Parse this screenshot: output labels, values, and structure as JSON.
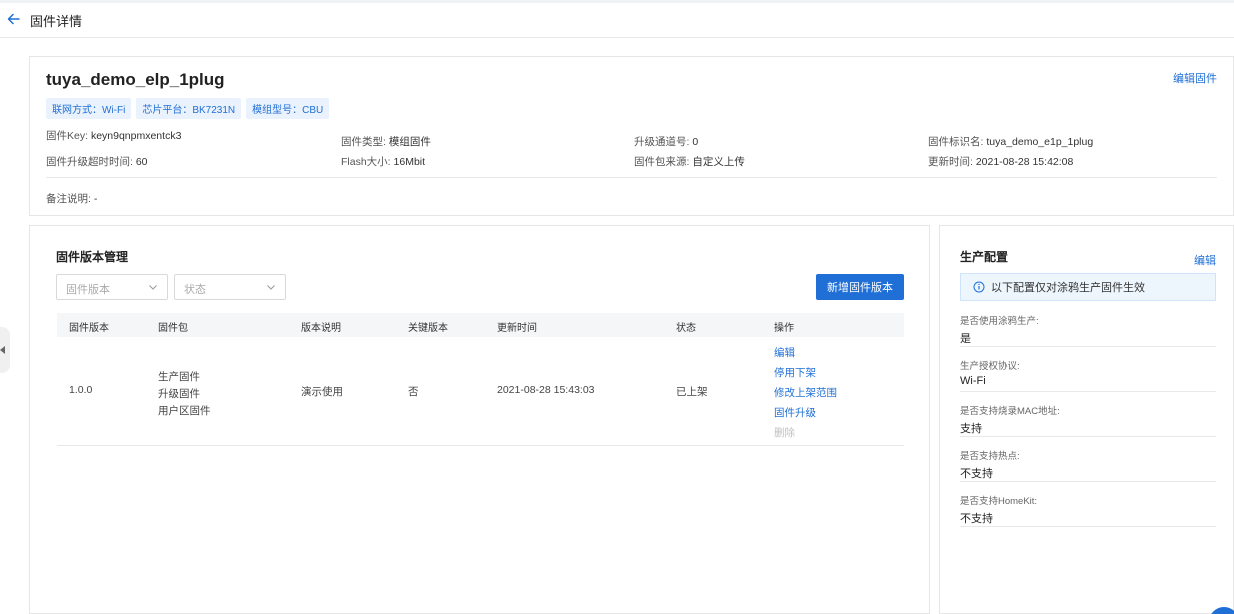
{
  "header": {
    "title": "固件详情"
  },
  "firmware": {
    "name": "tuya_demo_elp_1plug",
    "edit_label": "编辑固件",
    "tags": [
      "联网方式：Wi-Fi",
      "芯片平台：BK7231N",
      "模组型号：CBU"
    ],
    "meta": {
      "key_label": "固件Key: ",
      "key_value": "keyn9qnpmxentck3",
      "timeout_label": "固件升级超时时间: ",
      "timeout_value": "60",
      "type_label": "固件类型: ",
      "type_value": "模组固件",
      "flash_label": "Flash大小: ",
      "flash_value": "16Mbit",
      "channel_label": "升级通道号: ",
      "channel_value": "0",
      "source_label": "固件包来源: ",
      "source_value": "自定义上传",
      "identifier_label": "固件标识名: ",
      "identifier_value": "tuya_demo_e1p_1plug",
      "updated_label": "更新时间: ",
      "updated_value": "2021-08-28 15:42:08"
    },
    "remark_label": "备注说明: ",
    "remark_value": "-"
  },
  "versions": {
    "title": "固件版本管理",
    "filter_version_placeholder": "固件版本",
    "filter_status_placeholder": "状态",
    "add_button": "新增固件版本",
    "columns": [
      "固件版本",
      "固件包",
      "版本说明",
      "关键版本",
      "更新时间",
      "状态",
      "操作"
    ],
    "rows": [
      {
        "version": "1.0.0",
        "packages": [
          "生产固件",
          "升级固件",
          "用户区固件"
        ],
        "description": "演示使用",
        "key_version": "否",
        "updated": "2021-08-28 15:43:03",
        "status": "已上架",
        "actions": [
          "编辑",
          "停用下架",
          "修改上架范围",
          "固件升级",
          "删除"
        ]
      }
    ]
  },
  "production": {
    "title": "生产配置",
    "edit_label": "编辑",
    "notice": "以下配置仅对涂鸦生产固件生效",
    "fields": [
      {
        "label": "是否使用涂鸦生产:",
        "value": "是"
      },
      {
        "label": "生产授权协议:",
        "value": "Wi-Fi"
      },
      {
        "label": "是否支持烧录MAC地址:",
        "value": "支持"
      },
      {
        "label": "是否支持热点:",
        "value": "不支持"
      },
      {
        "label": "是否支持HomeKit:",
        "value": "不支持"
      }
    ]
  },
  "colors": {
    "accent": "#1f6fd6",
    "tag_bg": "#eaf2fd",
    "notice_bg": "#eef6fd",
    "disabled": "#bfbfbf"
  },
  "icons": {
    "back": "arrow-left-icon",
    "dropdown": "chevron-down-icon",
    "notice": "info-circle-icon",
    "collapse": "caret-left-icon"
  }
}
